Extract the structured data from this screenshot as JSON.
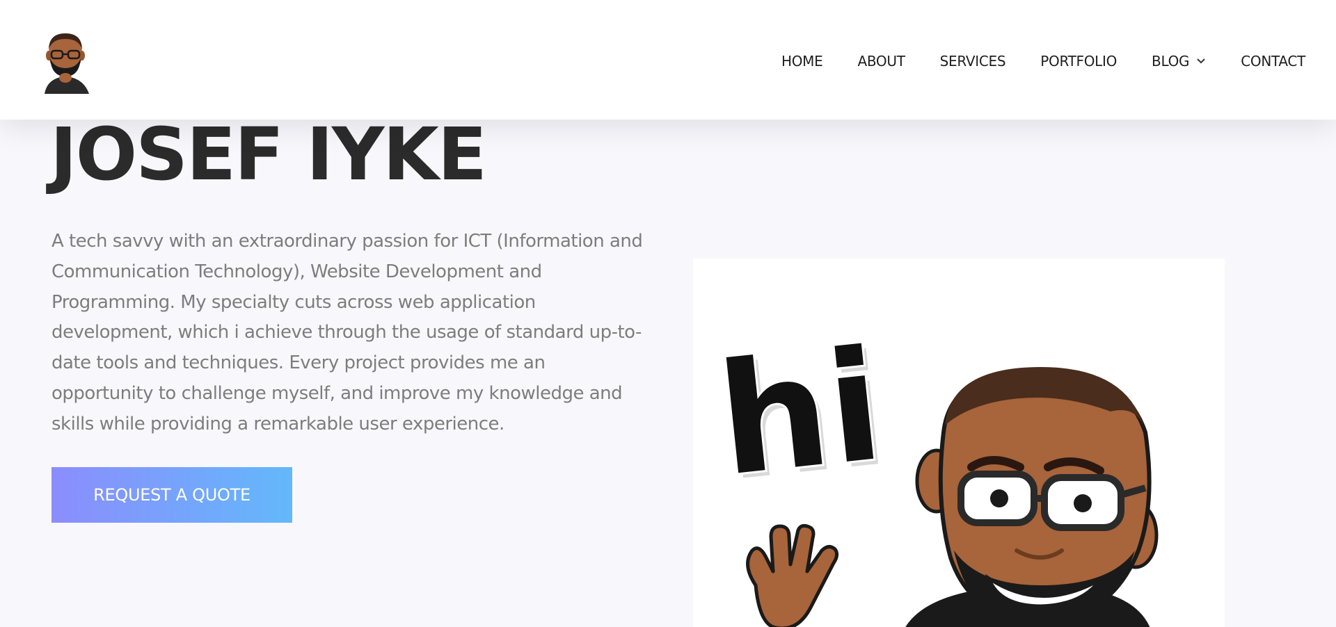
{
  "nav": {
    "items": [
      {
        "label": "HOME"
      },
      {
        "label": "ABOUT"
      },
      {
        "label": "SERVICES"
      },
      {
        "label": "PORTFOLIO"
      },
      {
        "label": "BLOG"
      },
      {
        "label": "CONTACT"
      }
    ]
  },
  "hero": {
    "title": "JOSEF IYKE",
    "description": "A tech savvy with an extraordinary passion for ICT (Information and Communication Technology), Website Development and Programming. My specialty cuts across web application development, which i achieve through the usage of standard up-to-date tools and techniques. Every project provides me an opportunity to challenge myself, and improve my knowledge and skills while providing a remarkable user experience.",
    "cta_label": "REQUEST A QUOTE",
    "image_text": "hi"
  },
  "colors": {
    "background": "#f8f7fc",
    "header": "#ffffff",
    "title": "#2b2b2b",
    "body_text": "#7d7d7d",
    "cta_gradient_start": "#8b8dfd",
    "cta_gradient_end": "#63b8fb",
    "skin": "#a8643a",
    "beard": "#1a1a1a"
  },
  "icons": {
    "logo": "bitmoji-avatar-icon",
    "dropdown": "chevron-down-icon",
    "wave": "waving-hand-icon"
  }
}
